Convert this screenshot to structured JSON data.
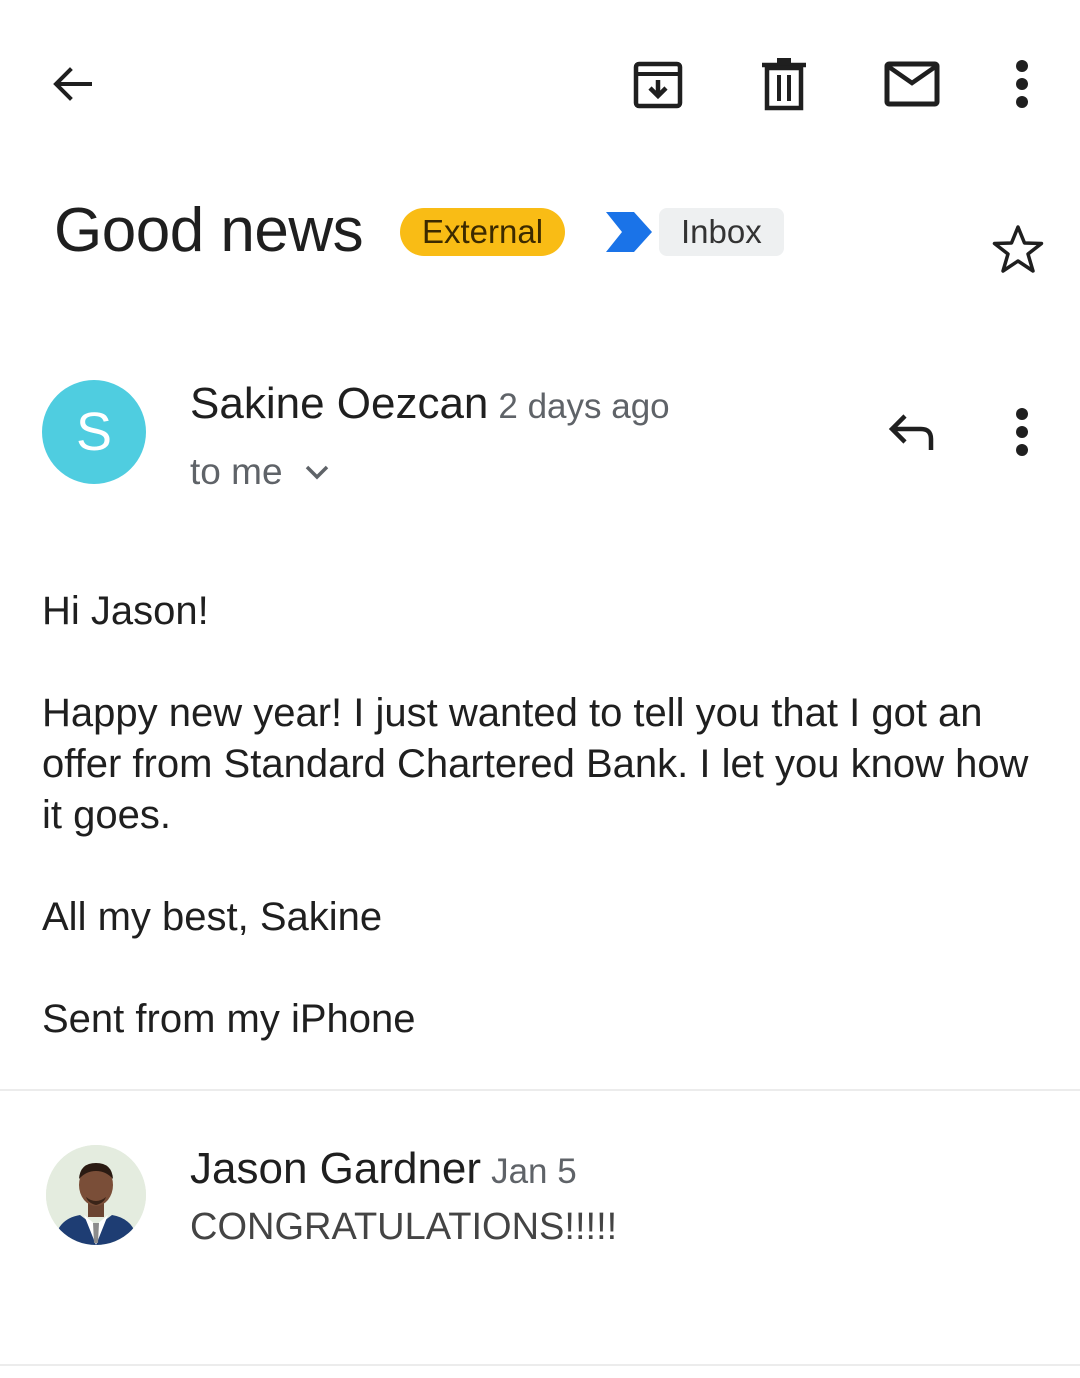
{
  "toolbar": {
    "back_icon": "arrow-back-icon",
    "archive_icon": "archive-icon",
    "delete_icon": "trash-icon",
    "mark_unread_icon": "mail-icon",
    "more_icon": "more-vert-icon"
  },
  "header": {
    "subject": "Good news",
    "label_external": "External",
    "label_inbox": "Inbox",
    "star_icon": "star-outline-icon",
    "colors": {
      "external_chip": "#f9bc15",
      "importance_marker": "#1a73e8",
      "inbox_chip": "#eef0f1"
    }
  },
  "message": {
    "avatar_letter": "S",
    "avatar_color": "#4fcde0",
    "sender": "Sakine Oezcan",
    "time": "2 days ago",
    "recipients": "to me",
    "body": {
      "greeting": "Hi Jason!",
      "paragraph": "Happy new year!  I just wanted to tell you that I got an offer from Standard Chartered Bank.  I let you know how it goes.",
      "signoff": "All my best, Sakine",
      "signature": "Sent from my iPhone"
    }
  },
  "reply_message": {
    "sender": "Jason Gardner",
    "time": "Jan 5",
    "snippet": "CONGRATULATIONS!!!!!"
  }
}
